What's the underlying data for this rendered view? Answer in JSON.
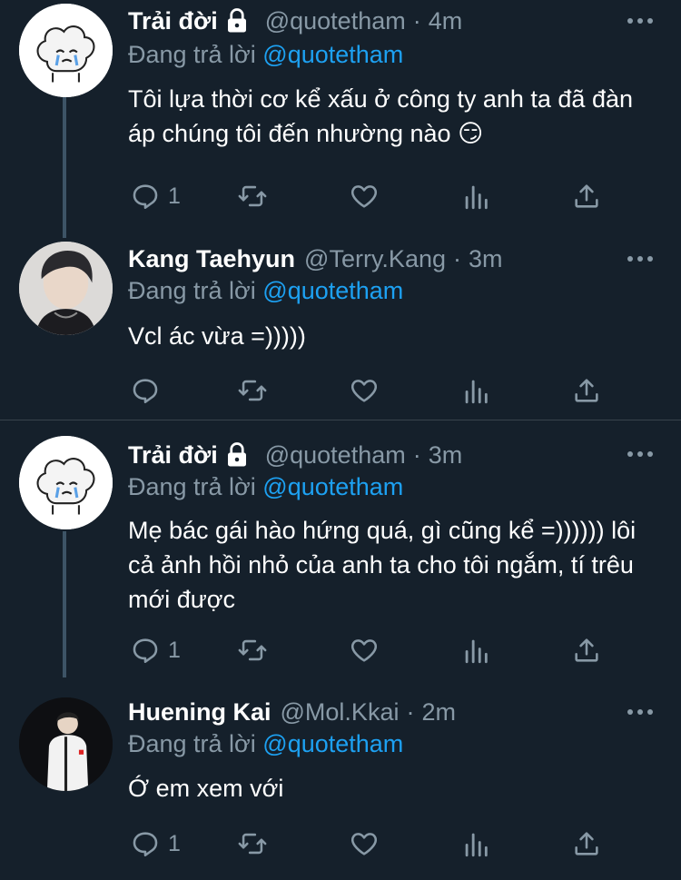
{
  "tweets": [
    {
      "name": "Trải đời",
      "handle": "@quotetham",
      "time": "4m",
      "replying_prefix": "Đang trả lời",
      "replying_to": "@quotetham",
      "text": "Tôi lựa thời cơ kể xấu ở công ty anh ta đã đàn áp chúng tôi đến nhường nào 😏",
      "reply_count": "1",
      "retweet_count": "",
      "like_count": ""
    },
    {
      "name": "Kang Taehyun",
      "handle": "@Terry.Kang",
      "time": "3m",
      "replying_prefix": "Đang trả lời",
      "replying_to": "@quotetham",
      "text": "Vcl ác vừa =)))))",
      "reply_count": "",
      "retweet_count": "",
      "like_count": ""
    },
    {
      "name": "Trải đời",
      "handle": "@quotetham",
      "time": "3m",
      "replying_prefix": "Đang trả lời",
      "replying_to": "@quotetham",
      "text": "Mẹ bác gái hào hứng quá, gì cũng kể =)))))) lôi cả ảnh hồi nhỏ của anh ta cho tôi ngắm, tí trêu mới được",
      "reply_count": "1",
      "retweet_count": "",
      "like_count": ""
    },
    {
      "name": "Huening Kai",
      "handle": "@Mol.Kkai",
      "time": "2m",
      "replying_prefix": "Đang trả lời",
      "replying_to": "@quotetham",
      "text": "Ớ em xem với",
      "reply_count": "1",
      "retweet_count": "",
      "like_count": ""
    }
  ],
  "separator": "·",
  "icons": {
    "reply": "reply-icon",
    "retweet": "retweet-icon",
    "like": "heart-icon",
    "stats": "analytics-icon",
    "share": "share-icon",
    "lock": "lock-icon",
    "more": "more-icon"
  },
  "colors": {
    "background": "#15202b",
    "text": "#ffffff",
    "muted": "#8899a6",
    "accent": "#1da1f2",
    "divider": "#38444d"
  }
}
